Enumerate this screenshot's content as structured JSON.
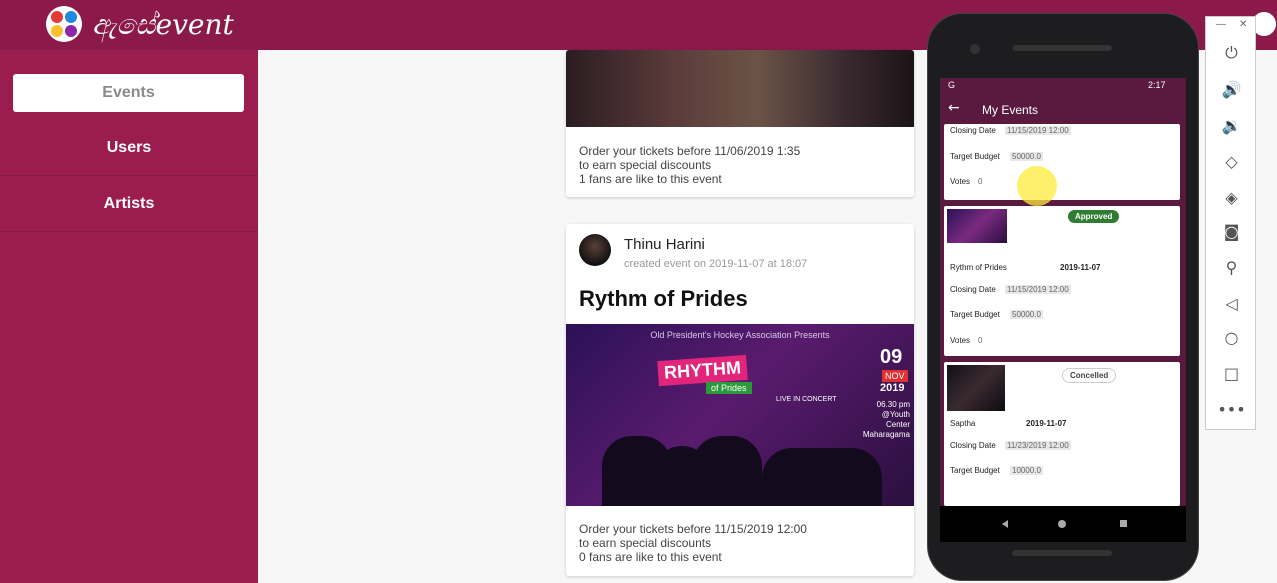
{
  "app": {
    "logo_text": "ඇසේevent"
  },
  "sidebar": {
    "items": [
      {
        "label": "Events"
      },
      {
        "label": "Users"
      },
      {
        "label": "Artists"
      }
    ]
  },
  "feed": {
    "card1": {
      "lines": [
        "Order your tickets before 11/06/2019 1:35",
        "to earn special discounts",
        "1 fans are like to this event"
      ]
    },
    "card2": {
      "author": "Thinu Harini",
      "created": "created event on 2019-11-07 at 18:07",
      "title": "Rythm of Prides",
      "poster": {
        "header": "Old President's Hockey Association Presents",
        "main": "RHYTHM",
        "sub": "of Prides",
        "day": "09",
        "month": "NOV",
        "year": "2019",
        "venue": "06.30 pm @Youth Center Maharagama",
        "live": "LIVE IN CONCERT"
      },
      "lines": [
        "Order your tickets before 11/15/2019 12:00",
        "to earn special discounts",
        "0 fans are like to this event"
      ]
    }
  },
  "phone": {
    "status": {
      "left": "G",
      "time": "2:17"
    },
    "appbar_title": "My Events",
    "labels": {
      "closing": "Closing Date",
      "budget": "Target Budget",
      "votes": "Votes"
    },
    "events": [
      {
        "closing": "11/15/2019 12:00",
        "budget": "50000.0",
        "votes": "0"
      },
      {
        "badge": "Approved",
        "name": "Rythm of Prides",
        "date": "2019-11-07",
        "closing": "11/15/2019 12:00",
        "budget": "50000.0",
        "votes": "0"
      },
      {
        "badge": "Concelled",
        "name": "Saptha",
        "date": "2019-11-07",
        "closing": "11/23/2019 12:00",
        "budget": "10000.0"
      }
    ]
  },
  "colors": {
    "brand": "#8b1a4a",
    "sidebar": "#9b1d4f",
    "phone_app": "#5a1a40",
    "approved": "#2e7d32"
  },
  "emulator_tools": [
    "power-icon",
    "volume-up-icon",
    "volume-down-icon",
    "rotate-left-icon",
    "rotate-right-icon",
    "camera-icon",
    "zoom-icon",
    "back-icon",
    "home-icon",
    "overview-icon",
    "more-icon"
  ]
}
